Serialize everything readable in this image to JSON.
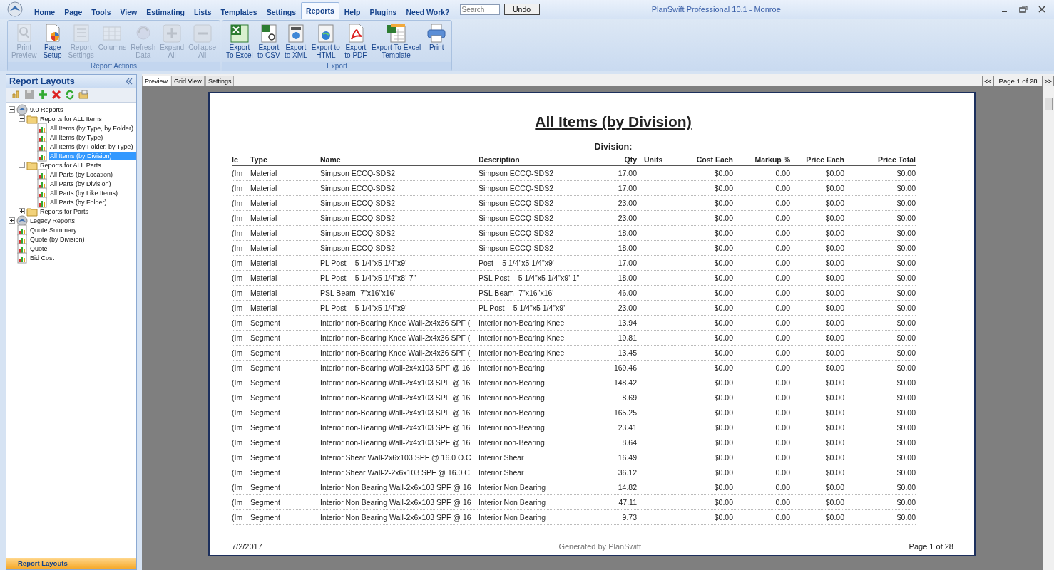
{
  "window": {
    "title": "PlanSwift Professional 10.1 - Monroe"
  },
  "menu": [
    {
      "label": "Home",
      "selected": false
    },
    {
      "label": "Page",
      "selected": false
    },
    {
      "label": "Tools",
      "selected": false
    },
    {
      "label": "View",
      "selected": false
    },
    {
      "label": "Estimating",
      "selected": false
    },
    {
      "label": "Lists",
      "selected": false
    },
    {
      "label": "Templates",
      "selected": false
    },
    {
      "label": "Settings",
      "selected": false
    },
    {
      "label": "Reports",
      "selected": true
    },
    {
      "label": "Help",
      "selected": false
    },
    {
      "label": "Plugins",
      "selected": false
    },
    {
      "label": "Need Work?",
      "selected": false
    }
  ],
  "search": {
    "placeholder": "Search"
  },
  "undo_button": "Undo",
  "ribbon": [
    {
      "label": "Report Actions",
      "buttons": [
        {
          "label": "Print\nPreview",
          "disabled": true
        },
        {
          "label": "Page\nSetup",
          "disabled": false
        },
        {
          "label": "Report\nSettings",
          "disabled": true
        },
        {
          "label": "Columns",
          "disabled": true
        },
        {
          "label": "Refresh\nData",
          "disabled": true
        },
        {
          "label": "Expand\nAll",
          "disabled": true
        },
        {
          "label": "Collapse\nAll",
          "disabled": true
        }
      ]
    },
    {
      "label": "Export",
      "buttons": [
        {
          "label": "Export\nTo Excel",
          "disabled": false
        },
        {
          "label": "Export\nto CSV",
          "disabled": false
        },
        {
          "label": "Export\nto XML",
          "disabled": false
        },
        {
          "label": "Export to\nHTML",
          "disabled": false
        },
        {
          "label": "Export\nto PDF",
          "disabled": false
        },
        {
          "label": "Export To Excel\nTemplate",
          "disabled": false
        },
        {
          "label": "Print",
          "disabled": false
        }
      ]
    }
  ],
  "sidebar": {
    "title": "Report Layouts",
    "footer": "Report Layouts",
    "tree": [
      {
        "label": "9.0 Reports",
        "kind": "group",
        "expanded": true,
        "selected": false,
        "children": [
          {
            "label": "Reports for ALL Items",
            "kind": "folder",
            "expanded": true,
            "selected": false,
            "children": [
              {
                "label": "All Items (by Type, by Folder)",
                "kind": "report",
                "selected": false
              },
              {
                "label": "All Items (by Type)",
                "kind": "report",
                "selected": false
              },
              {
                "label": "All Items (by Folder, by Type)",
                "kind": "report",
                "selected": false
              },
              {
                "label": "All Items (by Division)",
                "kind": "report",
                "selected": true
              }
            ]
          },
          {
            "label": "Reports for ALL Parts",
            "kind": "folder",
            "expanded": true,
            "selected": false,
            "children": [
              {
                "label": "All Parts (by Location)",
                "kind": "report",
                "selected": false
              },
              {
                "label": "All Parts (by Division)",
                "kind": "report",
                "selected": false
              },
              {
                "label": "All Parts (by Like Items)",
                "kind": "report",
                "selected": false
              },
              {
                "label": "All Parts (by Folder)",
                "kind": "report",
                "selected": false
              }
            ]
          },
          {
            "label": "Reports for Parts",
            "kind": "folder",
            "expanded": false,
            "selected": false
          }
        ]
      },
      {
        "label": "Legacy Reports",
        "kind": "group",
        "expanded": false,
        "selected": false
      },
      {
        "label": "Quote Summary",
        "kind": "report",
        "selected": false
      },
      {
        "label": "Quote (by Division)",
        "kind": "report",
        "selected": false
      },
      {
        "label": "Quote",
        "kind": "report",
        "selected": false
      },
      {
        "label": "Bid Cost",
        "kind": "report",
        "selected": false
      }
    ]
  },
  "view_tabs": [
    {
      "label": "Preview",
      "selected": true
    },
    {
      "label": "Grid View",
      "selected": false
    },
    {
      "label": "Settings",
      "selected": false
    }
  ],
  "pager": {
    "prev": "<<",
    "page": "Page 1 of 28",
    "next": ">>"
  },
  "report": {
    "title": "All Items (by Division)",
    "group_heading": "Division:",
    "columns": [
      "Ic",
      "Type",
      "Name",
      "Description",
      "Qty",
      "Units",
      "Cost Each",
      "Markup %",
      "Price Each",
      "Price Total"
    ],
    "rows": [
      {
        "ic": "(Im",
        "type": "Material",
        "name": "Simpson ECCQ-SDS2",
        "description": "Simpson ECCQ-SDS2",
        "qty": "17.00",
        "cost_each": "$0.00",
        "markup": "0.00",
        "price_each": "$0.00",
        "price_total": "$0.00"
      },
      {
        "ic": "(Im",
        "type": "Material",
        "name": "Simpson ECCQ-SDS2",
        "description": "Simpson ECCQ-SDS2",
        "qty": "17.00",
        "cost_each": "$0.00",
        "markup": "0.00",
        "price_each": "$0.00",
        "price_total": "$0.00"
      },
      {
        "ic": "(Im",
        "type": "Material",
        "name": "Simpson ECCQ-SDS2",
        "description": "Simpson ECCQ-SDS2",
        "qty": "23.00",
        "cost_each": "$0.00",
        "markup": "0.00",
        "price_each": "$0.00",
        "price_total": "$0.00"
      },
      {
        "ic": "(Im",
        "type": "Material",
        "name": "Simpson ECCQ-SDS2",
        "description": "Simpson ECCQ-SDS2",
        "qty": "23.00",
        "cost_each": "$0.00",
        "markup": "0.00",
        "price_each": "$0.00",
        "price_total": "$0.00"
      },
      {
        "ic": "(Im",
        "type": "Material",
        "name": "Simpson ECCQ-SDS2",
        "description": "Simpson ECCQ-SDS2",
        "qty": "18.00",
        "cost_each": "$0.00",
        "markup": "0.00",
        "price_each": "$0.00",
        "price_total": "$0.00"
      },
      {
        "ic": "(Im",
        "type": "Material",
        "name": "Simpson ECCQ-SDS2",
        "description": "Simpson ECCQ-SDS2",
        "qty": "18.00",
        "cost_each": "$0.00",
        "markup": "0.00",
        "price_each": "$0.00",
        "price_total": "$0.00"
      },
      {
        "ic": "(Im",
        "type": "Material",
        "name": "PL Post -  5 1/4\"x5 1/4\"x9'",
        "description": "Post -  5 1/4\"x5 1/4\"x9'",
        "qty": "17.00",
        "cost_each": "$0.00",
        "markup": "0.00",
        "price_each": "$0.00",
        "price_total": "$0.00"
      },
      {
        "ic": "(Im",
        "type": "Material",
        "name": "PL Post -  5 1/4\"x5 1/4\"x8'-7\"",
        "description": "PSL Post -  5 1/4\"x5 1/4\"x9'-1\"",
        "qty": "18.00",
        "cost_each": "$0.00",
        "markup": "0.00",
        "price_each": "$0.00",
        "price_total": "$0.00"
      },
      {
        "ic": "(Im",
        "type": "Material",
        "name": "PSL Beam -7\"x16\"x16'",
        "description": "PSL Beam -7\"x16\"x16'",
        "qty": "46.00",
        "cost_each": "$0.00",
        "markup": "0.00",
        "price_each": "$0.00",
        "price_total": "$0.00"
      },
      {
        "ic": "(Im",
        "type": "Material",
        "name": "PL Post -  5 1/4\"x5 1/4\"x9'",
        "description": "PL Post -  5 1/4\"x5 1/4\"x9'",
        "qty": "23.00",
        "cost_each": "$0.00",
        "markup": "0.00",
        "price_each": "$0.00",
        "price_total": "$0.00"
      },
      {
        "ic": "(Im",
        "type": "Segment",
        "name": "Interior non-Bearing Knee Wall-2x4x36 SPF (",
        "description": "Interior non-Bearing Knee",
        "qty": "13.94",
        "cost_each": "$0.00",
        "markup": "0.00",
        "price_each": "$0.00",
        "price_total": "$0.00"
      },
      {
        "ic": "(Im",
        "type": "Segment",
        "name": "Interior non-Bearing Knee Wall-2x4x36 SPF (",
        "description": "Interior non-Bearing Knee",
        "qty": "19.81",
        "cost_each": "$0.00",
        "markup": "0.00",
        "price_each": "$0.00",
        "price_total": "$0.00"
      },
      {
        "ic": "(Im",
        "type": "Segment",
        "name": "Interior non-Bearing Knee Wall-2x4x36 SPF (",
        "description": "Interior non-Bearing Knee",
        "qty": "13.45",
        "cost_each": "$0.00",
        "markup": "0.00",
        "price_each": "$0.00",
        "price_total": "$0.00"
      },
      {
        "ic": "(Im",
        "type": "Segment",
        "name": "Interior non-Bearing Wall-2x4x103 SPF @ 16",
        "description": "Interior non-Bearing",
        "qty": "169.46",
        "cost_each": "$0.00",
        "markup": "0.00",
        "price_each": "$0.00",
        "price_total": "$0.00"
      },
      {
        "ic": "(Im",
        "type": "Segment",
        "name": "Interior non-Bearing Wall-2x4x103 SPF @ 16",
        "description": "Interior non-Bearing",
        "qty": "148.42",
        "cost_each": "$0.00",
        "markup": "0.00",
        "price_each": "$0.00",
        "price_total": "$0.00"
      },
      {
        "ic": "(Im",
        "type": "Segment",
        "name": "Interior non-Bearing Wall-2x4x103 SPF @ 16",
        "description": "Interior non-Bearing",
        "qty": "8.69",
        "cost_each": "$0.00",
        "markup": "0.00",
        "price_each": "$0.00",
        "price_total": "$0.00"
      },
      {
        "ic": "(Im",
        "type": "Segment",
        "name": "Interior non-Bearing Wall-2x4x103 SPF @ 16",
        "description": "Interior non-Bearing",
        "qty": "165.25",
        "cost_each": "$0.00",
        "markup": "0.00",
        "price_each": "$0.00",
        "price_total": "$0.00"
      },
      {
        "ic": "(Im",
        "type": "Segment",
        "name": "Interior non-Bearing Wall-2x4x103 SPF @ 16",
        "description": "Interior non-Bearing",
        "qty": "23.41",
        "cost_each": "$0.00",
        "markup": "0.00",
        "price_each": "$0.00",
        "price_total": "$0.00"
      },
      {
        "ic": "(Im",
        "type": "Segment",
        "name": "Interior non-Bearing Wall-2x4x103 SPF @ 16",
        "description": "Interior non-Bearing",
        "qty": "8.64",
        "cost_each": "$0.00",
        "markup": "0.00",
        "price_each": "$0.00",
        "price_total": "$0.00"
      },
      {
        "ic": "(Im",
        "type": "Segment",
        "name": "Interior Shear Wall-2x6x103 SPF @ 16.0 O.C",
        "description": "Interior Shear",
        "qty": "16.49",
        "cost_each": "$0.00",
        "markup": "0.00",
        "price_each": "$0.00",
        "price_total": "$0.00"
      },
      {
        "ic": "(Im",
        "type": "Segment",
        "name": "Interior Shear Wall-2-2x6x103 SPF @ 16.0 C",
        "description": "Interior Shear",
        "qty": "36.12",
        "cost_each": "$0.00",
        "markup": "0.00",
        "price_each": "$0.00",
        "price_total": "$0.00"
      },
      {
        "ic": "(Im",
        "type": "Segment",
        "name": "Interior Non Bearing Wall-2x6x103 SPF @ 16",
        "description": "Interior Non Bearing",
        "qty": "14.82",
        "cost_each": "$0.00",
        "markup": "0.00",
        "price_each": "$0.00",
        "price_total": "$0.00"
      },
      {
        "ic": "(Im",
        "type": "Segment",
        "name": "Interior Non Bearing Wall-2x6x103 SPF @ 16",
        "description": "Interior Non Bearing",
        "qty": "47.11",
        "cost_each": "$0.00",
        "markup": "0.00",
        "price_each": "$0.00",
        "price_total": "$0.00"
      },
      {
        "ic": "(Im",
        "type": "Segment",
        "name": "Interior Non Bearing Wall-2x6x103 SPF @ 16",
        "description": "Interior Non Bearing",
        "qty": "9.73",
        "cost_each": "$0.00",
        "markup": "0.00",
        "price_each": "$0.00",
        "price_total": "$0.00"
      }
    ],
    "footer": {
      "date": "7/2/2017",
      "generator": "Generated by PlanSwift",
      "page": "Page 1 of 28"
    }
  }
}
